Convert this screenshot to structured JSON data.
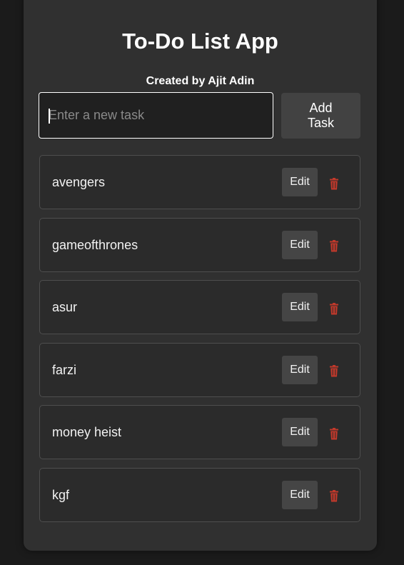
{
  "app": {
    "title": "To-Do List App",
    "credit": "Created by Ajit Adin"
  },
  "input": {
    "placeholder": "Enter a new task",
    "value": ""
  },
  "add_button": {
    "label": "Add Task"
  },
  "tasks": [
    {
      "text": "avengers",
      "edit_label": "Edit",
      "delete_icon": "trash-icon"
    },
    {
      "text": "gameofthrones",
      "edit_label": "Edit",
      "delete_icon": "trash-icon"
    },
    {
      "text": "asur",
      "edit_label": "Edit",
      "delete_icon": "trash-icon"
    },
    {
      "text": "farzi",
      "edit_label": "Edit",
      "delete_icon": "trash-icon"
    },
    {
      "text": "money heist",
      "edit_label": "Edit",
      "delete_icon": "trash-icon"
    },
    {
      "text": "kgf",
      "edit_label": "Edit",
      "delete_icon": "trash-icon"
    }
  ],
  "colors": {
    "page_background": "#1b1b1b",
    "card_background": "#303030",
    "task_background": "#2b2b2b",
    "button_background": "#424242",
    "delete_icon": "#c0392b"
  }
}
